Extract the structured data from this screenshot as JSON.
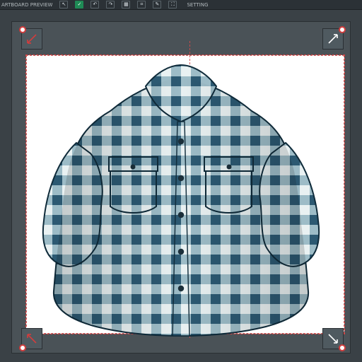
{
  "toolbar": {
    "title": "ARTBOARD PREVIEW",
    "buttons": [
      {
        "name": "select-icon",
        "glyph": "↖",
        "active": false
      },
      {
        "name": "confirm-icon",
        "glyph": "✓",
        "active": true
      },
      {
        "name": "undo-icon",
        "glyph": "↶",
        "active": false
      },
      {
        "name": "redo-icon",
        "glyph": "↷",
        "active": false
      },
      {
        "name": "image-icon",
        "glyph": "▦",
        "active": false
      },
      {
        "name": "crop-icon",
        "glyph": "⌗",
        "active": false
      },
      {
        "name": "pen-icon",
        "glyph": "✎",
        "active": false
      },
      {
        "name": "fill-icon",
        "glyph": "⛶",
        "active": false
      }
    ],
    "right_label": "SETTING"
  },
  "artboard": {
    "background_hex": "#ffffff",
    "guide_hex": "#c84242",
    "canvas_frame_hex": "#4a5257",
    "handle_accent_hex": "#d23d3d"
  },
  "shirt": {
    "base_hex": "#e9f1f2",
    "check_dark_hex": "#1f4d66",
    "check_mid_hex": "#5f8fa3",
    "outline_hex": "#0f2b3a",
    "button_hex": "#1b2f3a"
  }
}
